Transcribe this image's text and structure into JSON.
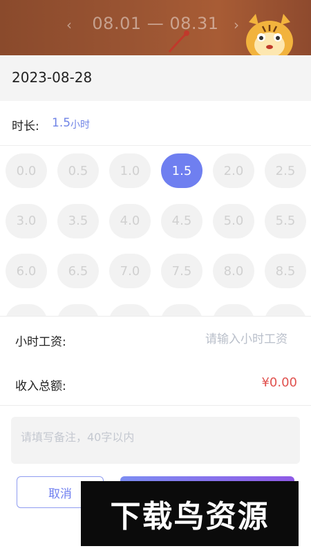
{
  "header": {
    "date_range": "08.01 — 08.31",
    "prev_icon": "chevron-left-icon",
    "next_icon": "chevron-right-icon"
  },
  "selected_date": "2023-08-28",
  "duration": {
    "label": "时长:",
    "value": "1.5",
    "unit": "小时"
  },
  "hour_options": [
    "0.0",
    "0.5",
    "1.0",
    "1.5",
    "2.0",
    "2.5",
    "3.0",
    "3.5",
    "4.0",
    "4.5",
    "5.0",
    "5.5",
    "6.0",
    "6.5",
    "7.0",
    "7.5",
    "8.0",
    "8.5"
  ],
  "selected_hour": "1.5",
  "hourly_wage": {
    "label": "小时工资:",
    "placeholder": "请输入小时工资",
    "value": ""
  },
  "total_income": {
    "label": "收入总额:",
    "value": "¥0.00"
  },
  "note": {
    "placeholder": "请填写备注，40字以内",
    "value": ""
  },
  "buttons": {
    "cancel": "取消",
    "confirm": ""
  },
  "watermark": "下载鸟资源",
  "colors": {
    "accent": "#6f7ff0",
    "income": "#e0524f",
    "banner": "#9b5533"
  }
}
